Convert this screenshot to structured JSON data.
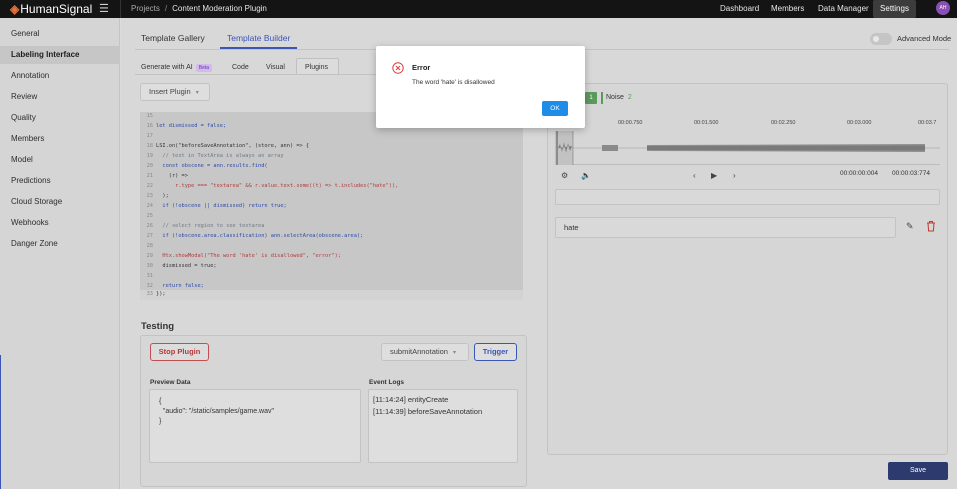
{
  "app": {
    "brand": "HumanSignal",
    "breadcrumb": {
      "root": "Projects",
      "separator": "/",
      "current": "Content Moderation Plugin"
    },
    "nav": [
      "Dashboard",
      "Members",
      "Data Manager",
      "Settings"
    ],
    "avatar_initials": "AH"
  },
  "sidebar": {
    "items": [
      {
        "label": "General"
      },
      {
        "label": "Labeling Interface"
      },
      {
        "label": "Annotation"
      },
      {
        "label": "Review"
      },
      {
        "label": "Quality"
      },
      {
        "label": "Members"
      },
      {
        "label": "Model"
      },
      {
        "label": "Predictions"
      },
      {
        "label": "Cloud Storage"
      },
      {
        "label": "Webhooks"
      },
      {
        "label": "Danger Zone"
      }
    ],
    "active": "Labeling Interface"
  },
  "tabs": {
    "gallery": "Template Gallery",
    "builder": "Template Builder",
    "advanced_mode": "Advanced Mode"
  },
  "subtabs": {
    "generate": "Generate with AI",
    "beta": "Beta",
    "code": "Code",
    "visual": "Visual",
    "plugins": "Plugins"
  },
  "insert_plugin": "Insert Plugin",
  "code_lines": [
    {
      "n": "15",
      "t": ""
    },
    {
      "n": "16",
      "t": "let dismissed = false;"
    },
    {
      "n": "17",
      "t": ""
    },
    {
      "n": "18",
      "t": "LSI.on(\"beforeSaveAnnotation\", (store, ann) => {"
    },
    {
      "n": "19",
      "t": "  // text in TextArea is always an array"
    },
    {
      "n": "20",
      "t": "  const obscene = ann.results.find("
    },
    {
      "n": "21",
      "t": "    (r) =>"
    },
    {
      "n": "22",
      "t": "      r.type === \"textarea\" && r.value.text.some((t) => t.includes(\"hate\")),"
    },
    {
      "n": "23",
      "t": "  );"
    },
    {
      "n": "24",
      "t": "  if (!obscene || dismissed) return true;"
    },
    {
      "n": "25",
      "t": ""
    },
    {
      "n": "26",
      "t": "  // select region to see textarea"
    },
    {
      "n": "27",
      "t": "  if (!obscene.area.classification) ann.selectArea(obscene.area);"
    },
    {
      "n": "28",
      "t": ""
    },
    {
      "n": "29",
      "t": "  Htx.showModal(\"The word 'hate' is disallowed\", \"error\");"
    },
    {
      "n": "30",
      "t": "  dismissed = true;"
    },
    {
      "n": "31",
      "t": ""
    },
    {
      "n": "32",
      "t": "  return false;"
    },
    {
      "n": "33",
      "t": "});"
    }
  ],
  "testing": {
    "title": "Testing",
    "stop": "Stop Plugin",
    "event_select": "submitAnnotation",
    "trigger": "Trigger",
    "preview_label": "Preview Data",
    "events_label": "Event Logs",
    "preview_lines": [
      "{",
      "  \"audio\": \"/static/samples/game.wav\"",
      "}"
    ],
    "events": [
      "[11:14:24] entityCreate",
      "[11:14:39] beforeSaveAnnotation"
    ]
  },
  "audio": {
    "label_key": "1",
    "label_name": "Noise",
    "label_hotkey": "2",
    "ticks": [
      "00:00.750",
      "00:01.500",
      "00:02.250",
      "00:03.000",
      "00:03.7"
    ],
    "current_time": "00:00:00:004",
    "duration": "00:00:03:774",
    "textarea_value": "hate"
  },
  "save": "Save",
  "modal": {
    "title": "Error",
    "message": "The word 'hate' is disallowed",
    "ok": "OK"
  },
  "colors": {
    "accent": "#3b56b7",
    "error": "#e03c3c",
    "ok_button": "#1f8ce8",
    "label_green": "#5c9a5c",
    "save_button": "#2c3a6e"
  }
}
